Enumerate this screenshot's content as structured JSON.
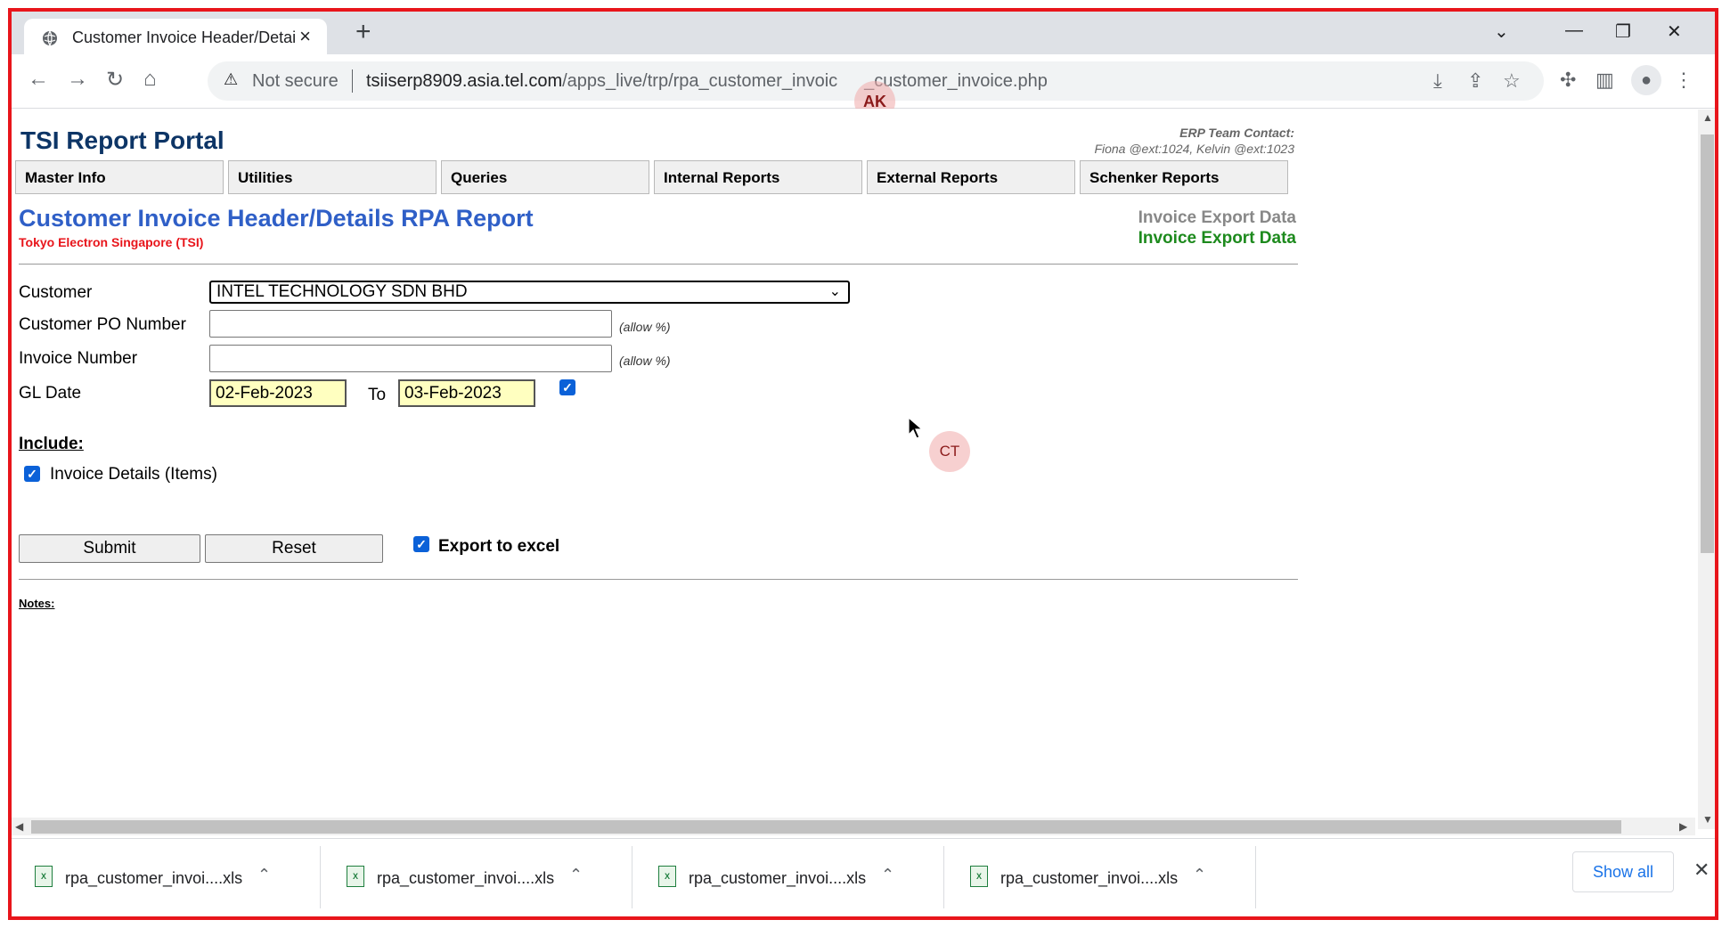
{
  "browser": {
    "tab_title": "Customer Invoice Header/Details",
    "url_domain": "tsiiserp8909.asia.tel.com",
    "url_path": "/apps_live/trp/rpa_customer_invoic",
    "url_tail": "_customer_invoice.php",
    "security_label": "Not secure",
    "overlay_badge": "AK"
  },
  "header": {
    "portal_title": "TSI Report Portal",
    "contact_heading": "ERP Team Contact:",
    "contact_names": "Fiona @ext:1024, Kelvin @ext:1023"
  },
  "menu": [
    "Master Info",
    "Utilities",
    "Queries",
    "Internal Reports",
    "External Reports",
    "Schenker Reports"
  ],
  "report": {
    "title": "Customer Invoice Header/Details RPA Report",
    "subtitle": "Tokyo Electron Singapore (TSI)",
    "export_label_grey": "Invoice Export Data",
    "export_label_green": "Invoice Export Data"
  },
  "form": {
    "customer_label": "Customer",
    "customer_value": "INTEL TECHNOLOGY SDN BHD",
    "po_label": "Customer PO Number",
    "po_value": "",
    "invoice_label": "Invoice Number",
    "invoice_value": "",
    "allow_hint": "(allow %)",
    "gl_label": "GL Date",
    "gl_from": "02-Feb-2023",
    "gl_to_label": "To",
    "gl_to": "03-Feb-2023",
    "gl_checked": true,
    "include_label": "Include:",
    "invoice_details_label": "Invoice Details (Items)",
    "invoice_details_checked": true,
    "submit_label": "Submit",
    "reset_label": "Reset",
    "export_label": "Export to excel",
    "export_checked": true,
    "notes_label": "Notes:"
  },
  "overlay_badge_ct": "CT",
  "downloads": {
    "items": [
      "rpa_customer_invoi....xls",
      "rpa_customer_invoi....xls",
      "rpa_customer_invoi....xls",
      "rpa_customer_invoi....xls"
    ],
    "show_all": "Show all"
  },
  "colors": {
    "frame_border": "#e8151b",
    "report_title": "#2f5fc7",
    "portal_title": "#0d3566",
    "export_green": "#1d8a1d",
    "date_bg": "#ffffc0"
  }
}
